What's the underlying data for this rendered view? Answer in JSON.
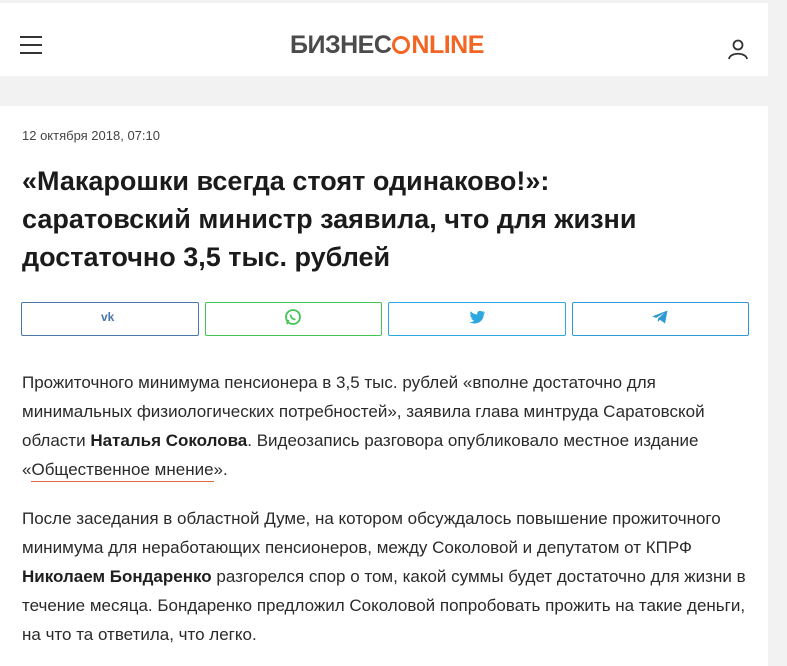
{
  "header": {
    "logo_part1": "БИЗНЕС",
    "logo_part2": "NLINE",
    "logo_colors": {
      "gray": "#4b4b4b",
      "orange": "#f26522"
    }
  },
  "article": {
    "date": "12 октября 2018, 07:10",
    "title": "«Макарошки всегда стоят одинаково!»: саратовский министр заявила, что для жизни достаточно 3,5 тыс. рублей",
    "share": {
      "vk": "vk-icon",
      "whatsapp": "whatsapp-icon",
      "twitter": "twitter-icon",
      "telegram": "telegram-icon"
    },
    "p1": {
      "text_a": "Прожиточного минимума пенсионера в 3,5 тыс. рублей «вполне достаточно для минимальных физиологических потребностей», заявила глава минтруда Саратовской области ",
      "name": "Наталья Соколова",
      "text_b": ". Видеозапись разговора опубликовало местное издание «",
      "link": "Общественное мнение",
      "text_c": "»."
    },
    "p2": {
      "text_a": "После заседания в областной Думе, на котором обсуждалось повышение прожиточного минимума для неработающих пенсионеров, между Соколовой и депутатом от КПРФ ",
      "name": "Николаем Бондаренко",
      "text_b": " разгорелся спор о том, какой суммы будет достаточно для жизни в течение месяца. Бондаренко предложил Соколовой попробовать прожить на такие деньги, на что та ответила, что легко."
    }
  }
}
